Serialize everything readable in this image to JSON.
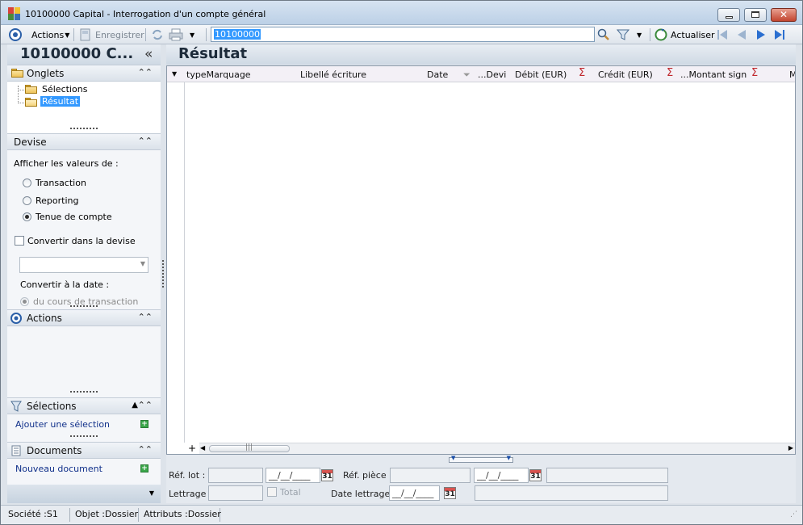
{
  "window": {
    "title": "10100000 Capital - Interrogation d'un compte général"
  },
  "toolbar": {
    "actions_label": "Actions",
    "save_label": "Enregistrer",
    "search_value": "10100000",
    "refresh_label": "Actualiser"
  },
  "left": {
    "title": "10100000 C...",
    "tabs_section": {
      "label": "Onglets",
      "items": [
        "Sélections",
        "Résultat"
      ]
    },
    "currency_section": {
      "label": "Devise",
      "show_values_label": "Afficher les valeurs de :",
      "options": [
        "Transaction",
        "Reporting",
        "Tenue de compte"
      ],
      "selected": "Tenue de compte",
      "convert_label": "Convertir dans la devise",
      "convert_date_label": "Convertir à la date :",
      "rate_option": "du cours de transaction"
    },
    "actions_section": {
      "label": "Actions"
    },
    "selections_section": {
      "label": "Sélections",
      "add_link": "Ajouter une sélection"
    },
    "documents_section": {
      "label": "Documents",
      "new_link": "Nouveau document"
    }
  },
  "main": {
    "title": "Résultat",
    "columns": [
      "typeMarquage",
      "Libellé écriture",
      "Date",
      "...Devi",
      "Débit (EUR)",
      "Crédit (EUR)",
      "...Montant sign",
      "M"
    ],
    "sum_symbol": "Σ",
    "add_row_symbol": "+"
  },
  "form": {
    "ref_lot_label": "Réf. lot :",
    "date_placeholder": "__/__/____",
    "calendar_day": "31",
    "ref_piece_label": "Réf. pièce :",
    "lettrage_label": "Lettrage :",
    "total_label": "Total",
    "date_lettrage_label": "Date lettrage :"
  },
  "status": {
    "societe": "Société :S1",
    "objet": "Objet :Dossier",
    "attributs": "Attributs :Dossier"
  }
}
